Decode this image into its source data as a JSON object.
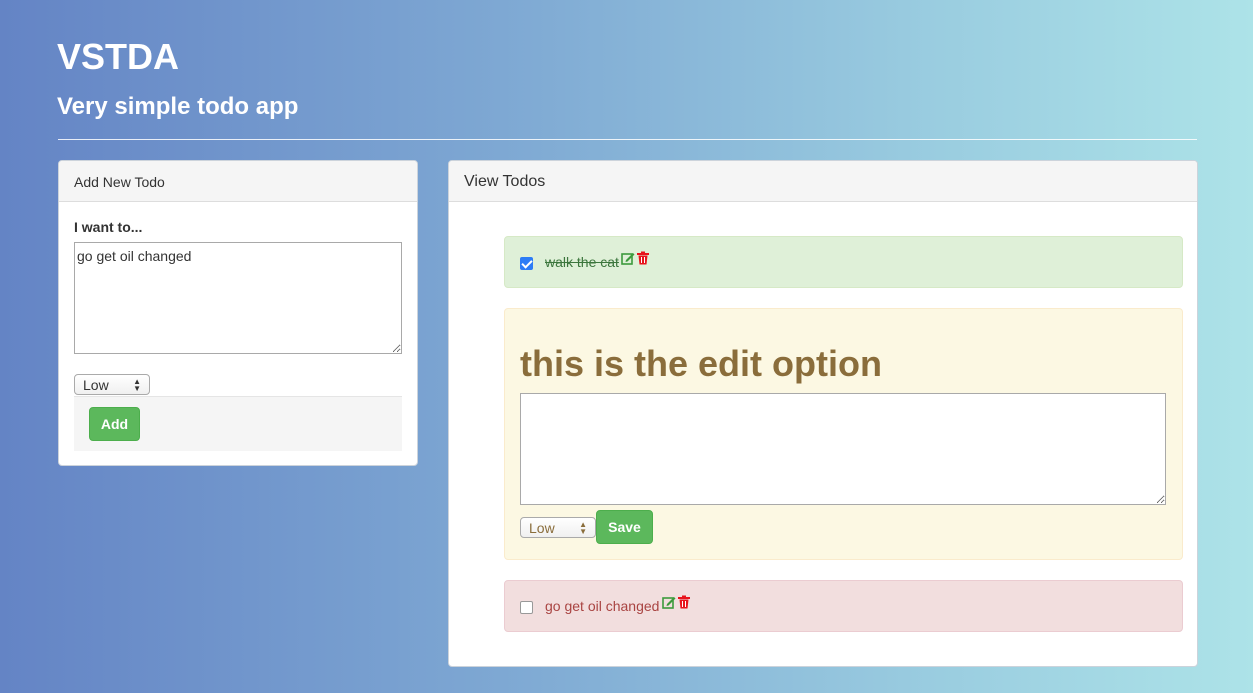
{
  "header": {
    "title": "VSTDA",
    "subtitle": "Very simple todo app"
  },
  "add_panel": {
    "heading": "Add New Todo",
    "field_label": "I want to...",
    "textarea_value": "go get oil changed",
    "priority_selected": "Low",
    "add_label": "Add"
  },
  "view_panel": {
    "heading": "View Todos",
    "todos": [
      {
        "text": "walk the cat",
        "checked": true,
        "status_color": "#dff0d8"
      },
      {
        "text": "go get oil changed",
        "checked": false,
        "status_color": "#f2dede"
      }
    ],
    "edit": {
      "heading": "this is the edit option",
      "textarea_value": "",
      "priority_selected": "Low",
      "save_label": "Save"
    }
  },
  "icons": {
    "edit": "edit-icon",
    "delete": "trash-icon"
  },
  "colors": {
    "success": "#5cb85c",
    "delete": "#e8131c",
    "edit_icon": "#3c9a3c"
  }
}
